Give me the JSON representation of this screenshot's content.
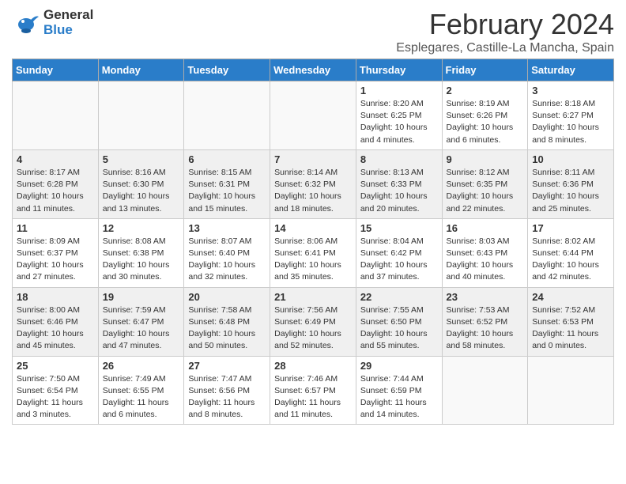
{
  "header": {
    "logo_general": "General",
    "logo_blue": "Blue",
    "month_title": "February 2024",
    "location": "Esplegares, Castille-La Mancha, Spain"
  },
  "weekdays": [
    "Sunday",
    "Monday",
    "Tuesday",
    "Wednesday",
    "Thursday",
    "Friday",
    "Saturday"
  ],
  "weeks": [
    [
      {
        "day": "",
        "info": ""
      },
      {
        "day": "",
        "info": ""
      },
      {
        "day": "",
        "info": ""
      },
      {
        "day": "",
        "info": ""
      },
      {
        "day": "1",
        "info": "Sunrise: 8:20 AM\nSunset: 6:25 PM\nDaylight: 10 hours\nand 4 minutes."
      },
      {
        "day": "2",
        "info": "Sunrise: 8:19 AM\nSunset: 6:26 PM\nDaylight: 10 hours\nand 6 minutes."
      },
      {
        "day": "3",
        "info": "Sunrise: 8:18 AM\nSunset: 6:27 PM\nDaylight: 10 hours\nand 8 minutes."
      }
    ],
    [
      {
        "day": "4",
        "info": "Sunrise: 8:17 AM\nSunset: 6:28 PM\nDaylight: 10 hours\nand 11 minutes."
      },
      {
        "day": "5",
        "info": "Sunrise: 8:16 AM\nSunset: 6:30 PM\nDaylight: 10 hours\nand 13 minutes."
      },
      {
        "day": "6",
        "info": "Sunrise: 8:15 AM\nSunset: 6:31 PM\nDaylight: 10 hours\nand 15 minutes."
      },
      {
        "day": "7",
        "info": "Sunrise: 8:14 AM\nSunset: 6:32 PM\nDaylight: 10 hours\nand 18 minutes."
      },
      {
        "day": "8",
        "info": "Sunrise: 8:13 AM\nSunset: 6:33 PM\nDaylight: 10 hours\nand 20 minutes."
      },
      {
        "day": "9",
        "info": "Sunrise: 8:12 AM\nSunset: 6:35 PM\nDaylight: 10 hours\nand 22 minutes."
      },
      {
        "day": "10",
        "info": "Sunrise: 8:11 AM\nSunset: 6:36 PM\nDaylight: 10 hours\nand 25 minutes."
      }
    ],
    [
      {
        "day": "11",
        "info": "Sunrise: 8:09 AM\nSunset: 6:37 PM\nDaylight: 10 hours\nand 27 minutes."
      },
      {
        "day": "12",
        "info": "Sunrise: 8:08 AM\nSunset: 6:38 PM\nDaylight: 10 hours\nand 30 minutes."
      },
      {
        "day": "13",
        "info": "Sunrise: 8:07 AM\nSunset: 6:40 PM\nDaylight: 10 hours\nand 32 minutes."
      },
      {
        "day": "14",
        "info": "Sunrise: 8:06 AM\nSunset: 6:41 PM\nDaylight: 10 hours\nand 35 minutes."
      },
      {
        "day": "15",
        "info": "Sunrise: 8:04 AM\nSunset: 6:42 PM\nDaylight: 10 hours\nand 37 minutes."
      },
      {
        "day": "16",
        "info": "Sunrise: 8:03 AM\nSunset: 6:43 PM\nDaylight: 10 hours\nand 40 minutes."
      },
      {
        "day": "17",
        "info": "Sunrise: 8:02 AM\nSunset: 6:44 PM\nDaylight: 10 hours\nand 42 minutes."
      }
    ],
    [
      {
        "day": "18",
        "info": "Sunrise: 8:00 AM\nSunset: 6:46 PM\nDaylight: 10 hours\nand 45 minutes."
      },
      {
        "day": "19",
        "info": "Sunrise: 7:59 AM\nSunset: 6:47 PM\nDaylight: 10 hours\nand 47 minutes."
      },
      {
        "day": "20",
        "info": "Sunrise: 7:58 AM\nSunset: 6:48 PM\nDaylight: 10 hours\nand 50 minutes."
      },
      {
        "day": "21",
        "info": "Sunrise: 7:56 AM\nSunset: 6:49 PM\nDaylight: 10 hours\nand 52 minutes."
      },
      {
        "day": "22",
        "info": "Sunrise: 7:55 AM\nSunset: 6:50 PM\nDaylight: 10 hours\nand 55 minutes."
      },
      {
        "day": "23",
        "info": "Sunrise: 7:53 AM\nSunset: 6:52 PM\nDaylight: 10 hours\nand 58 minutes."
      },
      {
        "day": "24",
        "info": "Sunrise: 7:52 AM\nSunset: 6:53 PM\nDaylight: 11 hours\nand 0 minutes."
      }
    ],
    [
      {
        "day": "25",
        "info": "Sunrise: 7:50 AM\nSunset: 6:54 PM\nDaylight: 11 hours\nand 3 minutes."
      },
      {
        "day": "26",
        "info": "Sunrise: 7:49 AM\nSunset: 6:55 PM\nDaylight: 11 hours\nand 6 minutes."
      },
      {
        "day": "27",
        "info": "Sunrise: 7:47 AM\nSunset: 6:56 PM\nDaylight: 11 hours\nand 8 minutes."
      },
      {
        "day": "28",
        "info": "Sunrise: 7:46 AM\nSunset: 6:57 PM\nDaylight: 11 hours\nand 11 minutes."
      },
      {
        "day": "29",
        "info": "Sunrise: 7:44 AM\nSunset: 6:59 PM\nDaylight: 11 hours\nand 14 minutes."
      },
      {
        "day": "",
        "info": ""
      },
      {
        "day": "",
        "info": ""
      }
    ]
  ]
}
